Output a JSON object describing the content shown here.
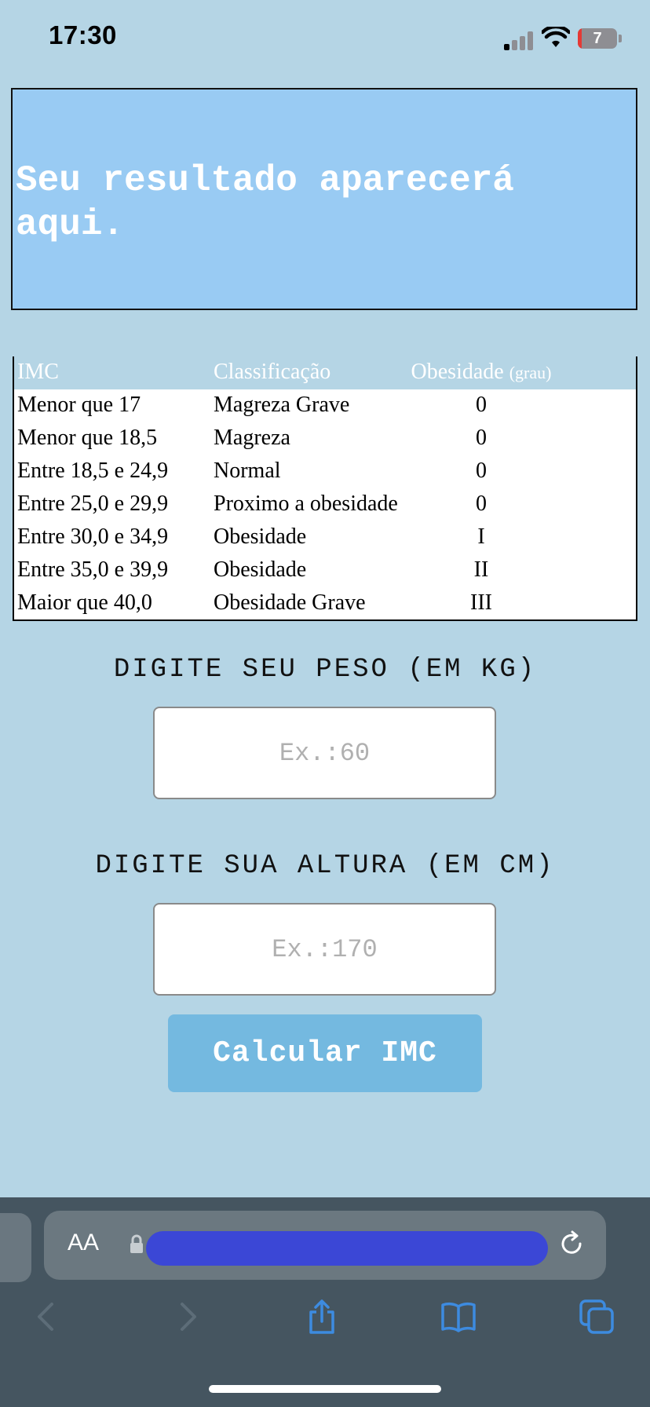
{
  "status_bar": {
    "time": "17:30",
    "battery_level": "7",
    "icons": [
      "signal-icon",
      "wifi-icon",
      "battery-icon"
    ]
  },
  "result": {
    "text": "Seu resultado aparecerá aqui."
  },
  "table": {
    "headers": {
      "imc": "IMC",
      "classification": "Classificação",
      "obesity": "Obesidade",
      "obesity_unit": "(grau)"
    },
    "rows": [
      {
        "imc": "Menor que 17",
        "classification": "Magreza Grave",
        "grade": "0"
      },
      {
        "imc": "Menor que 18,5",
        "classification": "Magreza",
        "grade": "0"
      },
      {
        "imc": "Entre 18,5 e 24,9",
        "classification": "Normal",
        "grade": "0"
      },
      {
        "imc": "Entre 25,0 e 29,9",
        "classification": "Proximo a obesidade",
        "grade": "0"
      },
      {
        "imc": "Entre 30,0 e 34,9",
        "classification": "Obesidade",
        "grade": "I"
      },
      {
        "imc": "Entre 35,0 e 39,9",
        "classification": "Obesidade",
        "grade": "II"
      },
      {
        "imc": "Maior que 40,0",
        "classification": "Obesidade Grave",
        "grade": "III"
      }
    ]
  },
  "form": {
    "weight_label": "DIGITE SEU PESO (EM KG)",
    "weight_placeholder": "Ex.:60",
    "height_label": "DIGITE SUA ALTURA (EM CM)",
    "height_placeholder": "Ex.:170",
    "calculate_label": "Calcular IMC"
  },
  "browser": {
    "text_size_label": "AA",
    "icons": [
      "lock-icon",
      "reload-icon",
      "back-icon",
      "forward-icon",
      "share-icon",
      "bookmarks-icon",
      "tabs-icon"
    ]
  },
  "colors": {
    "page_bg": "#b5d5e5",
    "result_bg": "#99cbf3",
    "button_bg": "#74b9e0",
    "browser_bar": "#455560",
    "toolbar_icon": "#3d8be0"
  }
}
